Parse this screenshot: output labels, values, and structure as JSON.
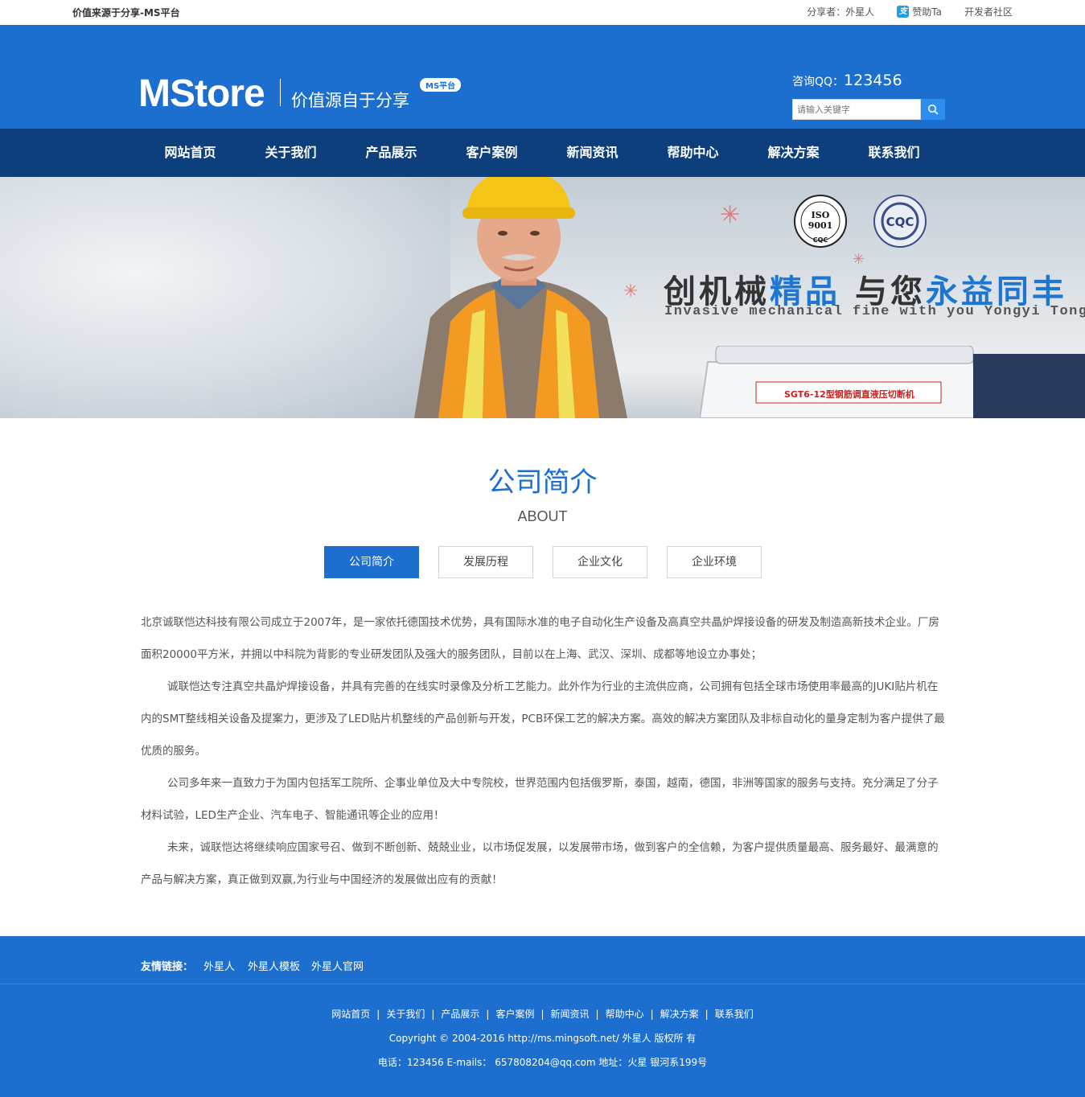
{
  "topbar": {
    "site_name": "价值来源于分享-MS平台",
    "sharer": "分享者：外星人",
    "donate": "赞助Ta",
    "dev_community": "开发者社区"
  },
  "header": {
    "logo": "MStore",
    "slogan": "价值源自于分享",
    "badge": "MS平台",
    "qq_label": "咨询QQ：",
    "qq_number": "123456",
    "search_placeholder": "请输入关键字"
  },
  "nav": {
    "items": [
      "网站首页",
      "关于我们",
      "产品展示",
      "客户案例",
      "新闻资讯",
      "帮助中心",
      "解决方案",
      "联系我们"
    ]
  },
  "banner": {
    "headline_1": "创机械",
    "headline_2": "精品",
    "headline_3": "与您",
    "headline_4": "永益同丰",
    "subline": "Invasive mechanical fine with you Yongyi TongFeng",
    "machine_label": "SGT6-12型钢筋调直液压切断机",
    "cert_iso": "ISO 9001",
    "cert_cqc": "CQC"
  },
  "about": {
    "title": "公司简介",
    "subtitle": "ABOUT",
    "tabs": [
      "公司简介",
      "发展历程",
      "企业文化",
      "企业环境"
    ],
    "p1": "北京诚联恺达科技有限公司成立于2007年，是一家依托德国技术优势，具有国际水准的电子自动化生产设备及高真空共晶炉焊接设备的研发及制造高新技术企业。厂房面积20000平方米，并拥以中科院为背影的专业研发团队及强大的服务团队，目前以在上海、武汉、深圳、成都等地设立办事处；",
    "p2": "诚联恺达专注真空共晶炉焊接设备，并具有完善的在线实时录像及分析工艺能力。此外作为行业的主流供应商，公司拥有包括全球市场使用率最高的JUKI贴片机在内的SMT整线相关设备及提案力，更涉及了LED贴片机整线的产品创新与开发，PCB环保工艺的解决方案。高效的解决方案团队及非标自动化的量身定制为客户提供了最优质的服务。",
    "p3": "公司多年来一直致力于为国内包括军工院所、企事业单位及大中专院校，世界范围内包括俄罗斯，泰国，越南，德国，非洲等国家的服务与支持。充分满足了分子材料试验，LED生产企业、汽车电子、智能通讯等企业的应用！",
    "p4": "未来，诚联恺达将继续响应国家号召、做到不断创新、兢兢业业，以市场促发展，以发展带市场，做到客户的全信赖，为客户提供质量最高、服务最好、最满意的产品与解决方案，真正做到双赢,为行业与中国经济的发展做出应有的贡献！"
  },
  "friend_links": {
    "label": "友情链接：",
    "items": [
      "外星人",
      "外星人模板",
      "外星人官网"
    ]
  },
  "footer": {
    "nav": [
      "网站首页",
      "关于我们",
      "产品展示",
      "客户案例",
      "新闻资讯",
      "帮助中心",
      "解决方案",
      "联系我们"
    ],
    "separator": "|",
    "copyright": "Copyright © 2004-2016 http://ms.mingsoft.net/ 外星人 版权所 有",
    "contact": "电话：123456 E-mails： 657808204@qq.com 地址：火星 银河系199号"
  },
  "colors": {
    "primary": "#1d6fcf",
    "nav_bg": "#0c3f7c",
    "search_button": "#2e8ef0"
  }
}
